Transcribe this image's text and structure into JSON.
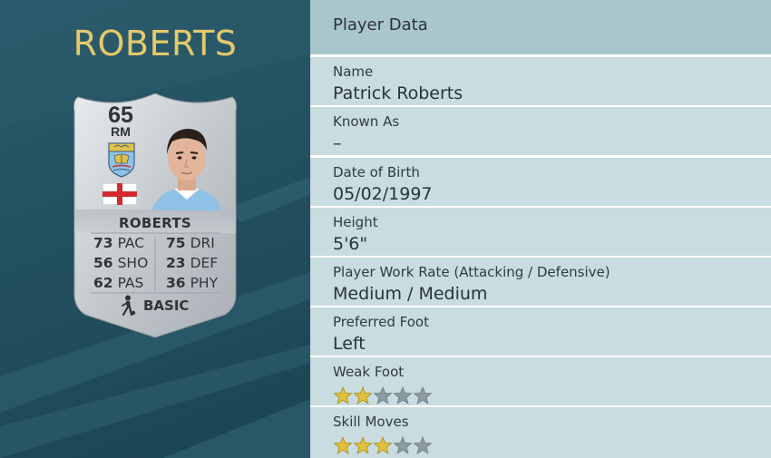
{
  "player_heading": "ROBERTS",
  "card": {
    "rating": "65",
    "position": "RM",
    "name": "ROBERTS",
    "stats": [
      {
        "value": "73",
        "label": "PAC"
      },
      {
        "value": "56",
        "label": "SHO"
      },
      {
        "value": "62",
        "label": "PAS"
      },
      {
        "value": "75",
        "label": "DRI"
      },
      {
        "value": "23",
        "label": "DEF"
      },
      {
        "value": "36",
        "label": "PHY"
      }
    ],
    "card_type": "BASIC",
    "nation_flag": "england-flag",
    "club_badge": "manchester-city-badge"
  },
  "panel": {
    "title": "Player Data",
    "fields": [
      {
        "label": "Name",
        "value": "Patrick Roberts"
      },
      {
        "label": "Known As",
        "value": "–"
      },
      {
        "label": "Date of Birth",
        "value": "05/02/1997"
      },
      {
        "label": "Height",
        "value": "5'6\""
      },
      {
        "label": "Player Work Rate (Attacking / Defensive)",
        "value": "Medium / Medium"
      },
      {
        "label": "Preferred Foot",
        "value": "Left"
      }
    ],
    "weak_foot": {
      "label": "Weak Foot",
      "rating": 2,
      "max": 5
    },
    "skill_moves": {
      "label": "Skill Moves",
      "rating": 3,
      "max": 5
    }
  },
  "colors": {
    "heading_gold": "#e6c96a",
    "star_gold": "#e0bf3c",
    "star_grey": "#8c9aa2",
    "row_bg": "#c9dcdf",
    "header_bg": "#a9c6cc"
  }
}
